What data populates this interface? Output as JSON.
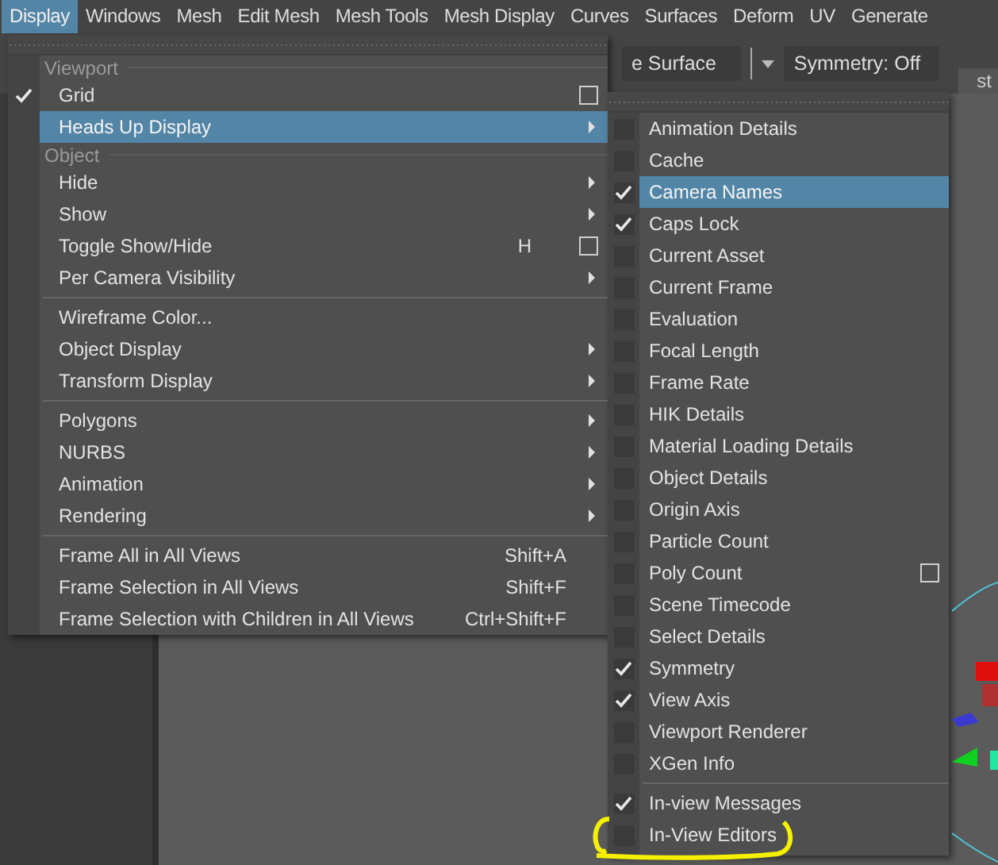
{
  "menu_bar": [
    {
      "label": "Display",
      "selected": true
    },
    {
      "label": "Windows",
      "selected": false
    },
    {
      "label": "Mesh",
      "selected": false
    },
    {
      "label": "Edit Mesh",
      "selected": false
    },
    {
      "label": "Mesh Tools",
      "selected": false
    },
    {
      "label": "Mesh Display",
      "selected": false
    },
    {
      "label": "Curves",
      "selected": false
    },
    {
      "label": "Surfaces",
      "selected": false
    },
    {
      "label": "Deform",
      "selected": false
    },
    {
      "label": "UV",
      "selected": false
    },
    {
      "label": "Generate",
      "selected": false
    }
  ],
  "toolbar": {
    "surface_field": "e Surface",
    "symmetry_field": "Symmetry: Off",
    "tab_fragment": "st"
  },
  "display_menu": [
    {
      "kind": "header",
      "label": "Viewport"
    },
    {
      "kind": "item",
      "label": "Grid",
      "checked": true,
      "selected": false,
      "option_box": true
    },
    {
      "kind": "item",
      "label": "Heads Up Display",
      "checked": false,
      "selected": true,
      "submenu": true
    },
    {
      "kind": "header",
      "label": "Object"
    },
    {
      "kind": "item",
      "label": "Hide",
      "checked": false,
      "selected": false,
      "submenu": true
    },
    {
      "kind": "item",
      "label": "Show",
      "checked": false,
      "selected": false,
      "submenu": true
    },
    {
      "kind": "item",
      "label": "Toggle Show/Hide",
      "checked": false,
      "selected": false,
      "shortcut": "H",
      "option_box": true
    },
    {
      "kind": "item",
      "label": "Per Camera Visibility",
      "checked": false,
      "selected": false,
      "submenu": true
    },
    {
      "kind": "separator"
    },
    {
      "kind": "item",
      "label": "Wireframe Color...",
      "checked": false,
      "selected": false
    },
    {
      "kind": "item",
      "label": "Object Display",
      "checked": false,
      "selected": false,
      "submenu": true
    },
    {
      "kind": "item",
      "label": "Transform Display",
      "checked": false,
      "selected": false,
      "submenu": true
    },
    {
      "kind": "separator"
    },
    {
      "kind": "item",
      "label": "Polygons",
      "checked": false,
      "selected": false,
      "submenu": true
    },
    {
      "kind": "item",
      "label": "NURBS",
      "checked": false,
      "selected": false,
      "submenu": true
    },
    {
      "kind": "item",
      "label": "Animation",
      "checked": false,
      "selected": false,
      "submenu": true
    },
    {
      "kind": "item",
      "label": "Rendering",
      "checked": false,
      "selected": false,
      "submenu": true
    },
    {
      "kind": "separator"
    },
    {
      "kind": "item",
      "label": "Frame All in All Views",
      "checked": false,
      "selected": false,
      "shortcut": "Shift+A"
    },
    {
      "kind": "item",
      "label": "Frame Selection in All Views",
      "checked": false,
      "selected": false,
      "shortcut": "Shift+F"
    },
    {
      "kind": "item",
      "label": "Frame Selection with Children in All Views",
      "checked": false,
      "selected": false,
      "shortcut": "Ctrl+Shift+F"
    }
  ],
  "hud_submenu": [
    {
      "kind": "item",
      "label": "Animation Details",
      "checked": false,
      "selected": false
    },
    {
      "kind": "item",
      "label": "Cache",
      "checked": false,
      "selected": false
    },
    {
      "kind": "item",
      "label": "Camera Names",
      "checked": true,
      "selected": true
    },
    {
      "kind": "item",
      "label": "Caps Lock",
      "checked": true,
      "selected": false
    },
    {
      "kind": "item",
      "label": "Current Asset",
      "checked": false,
      "selected": false
    },
    {
      "kind": "item",
      "label": "Current Frame",
      "checked": false,
      "selected": false
    },
    {
      "kind": "item",
      "label": "Evaluation",
      "checked": false,
      "selected": false
    },
    {
      "kind": "item",
      "label": "Focal Length",
      "checked": false,
      "selected": false
    },
    {
      "kind": "item",
      "label": "Frame Rate",
      "checked": false,
      "selected": false
    },
    {
      "kind": "item",
      "label": "HIK Details",
      "checked": false,
      "selected": false
    },
    {
      "kind": "item",
      "label": "Material Loading Details",
      "checked": false,
      "selected": false
    },
    {
      "kind": "item",
      "label": "Object Details",
      "checked": false,
      "selected": false
    },
    {
      "kind": "item",
      "label": "Origin Axis",
      "checked": false,
      "selected": false
    },
    {
      "kind": "item",
      "label": "Particle Count",
      "checked": false,
      "selected": false
    },
    {
      "kind": "item",
      "label": "Poly Count",
      "checked": false,
      "selected": false,
      "option_box": true
    },
    {
      "kind": "item",
      "label": "Scene Timecode",
      "checked": false,
      "selected": false
    },
    {
      "kind": "item",
      "label": "Select Details",
      "checked": false,
      "selected": false
    },
    {
      "kind": "item",
      "label": "Symmetry",
      "checked": true,
      "selected": false
    },
    {
      "kind": "item",
      "label": "View Axis",
      "checked": true,
      "selected": false
    },
    {
      "kind": "item",
      "label": "Viewport Renderer",
      "checked": false,
      "selected": false
    },
    {
      "kind": "item",
      "label": "XGen Info",
      "checked": false,
      "selected": false
    },
    {
      "kind": "separator"
    },
    {
      "kind": "item",
      "label": "In-view Messages",
      "checked": true,
      "selected": false
    },
    {
      "kind": "item",
      "label": "In-View Editors",
      "checked": false,
      "selected": false
    }
  ]
}
